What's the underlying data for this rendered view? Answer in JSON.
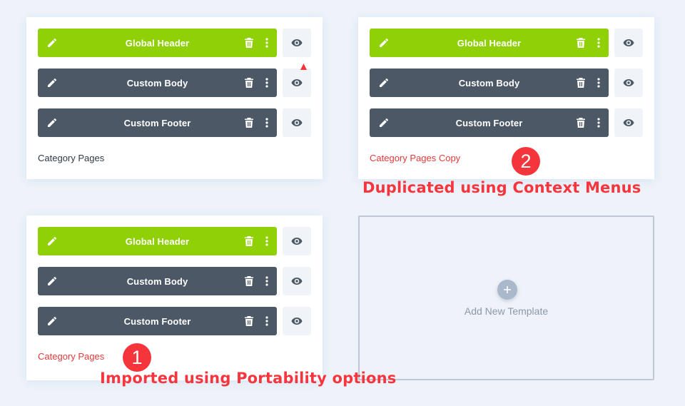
{
  "colors": {
    "page_bg": "#eff3f9",
    "header_green": "#8fd006",
    "layout_dark": "#4c5866",
    "annotation_red": "#f5363e",
    "template_name_red": "#e5393a"
  },
  "icons": {
    "edit": "pencil-icon",
    "delete": "trash-icon",
    "options": "vertical-dots-icon",
    "visibility": "eye-icon",
    "add": "plus-icon"
  },
  "templates": [
    {
      "layouts": [
        {
          "label": "Global Header",
          "style": "green"
        },
        {
          "label": "Custom Body",
          "style": "dark"
        },
        {
          "label": "Custom Footer",
          "style": "dark"
        }
      ],
      "name": "Category Pages"
    },
    {
      "layouts": [
        {
          "label": "Global Header",
          "style": "green"
        },
        {
          "label": "Custom Body",
          "style": "dark"
        },
        {
          "label": "Custom Footer",
          "style": "dark"
        }
      ],
      "name": "Category Pages Copy"
    },
    {
      "layouts": [
        {
          "label": "Global Header",
          "style": "green"
        },
        {
          "label": "Custom Body",
          "style": "dark"
        },
        {
          "label": "Custom Footer",
          "style": "dark"
        }
      ],
      "name": "Category Pages"
    }
  ],
  "add_template": {
    "label": "Add New Template"
  },
  "annotations": {
    "badge_1": "1",
    "badge_2": "2",
    "duplicated": "Duplicated using Context Menus",
    "imported": "Imported using Portability options"
  }
}
